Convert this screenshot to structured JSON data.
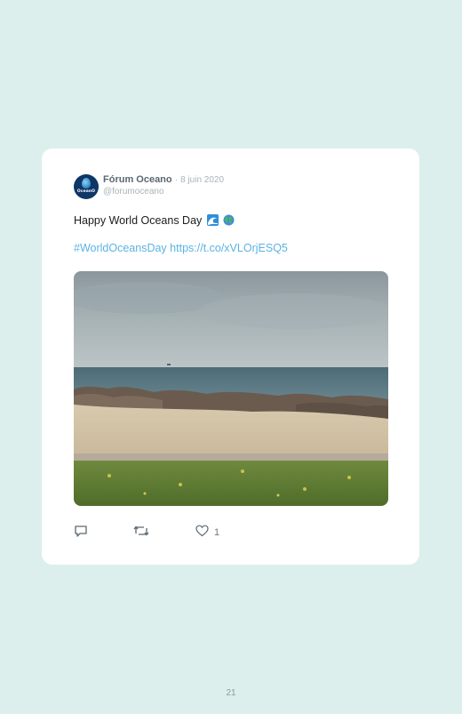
{
  "tweet": {
    "avatar_text": "OceanO",
    "display_name": "Fórum Oceano",
    "separator": "·",
    "date": "8 juin 2020",
    "handle": "@forumoceano",
    "text": "Happy World Oceans Day",
    "emojis": [
      "water-wave-icon",
      "globe-icon"
    ],
    "hashtag": "#WorldOceansDay",
    "link": "https://t.co/xVLOrjESQ5",
    "photo_alt": "rocky beach, sea and grass",
    "like_count": "1"
  },
  "page": {
    "number": "21"
  },
  "colors": {
    "page_background": "#dcefed",
    "link": "#5cb2e6",
    "name": "#5b6770",
    "muted": "#aab3b8"
  }
}
